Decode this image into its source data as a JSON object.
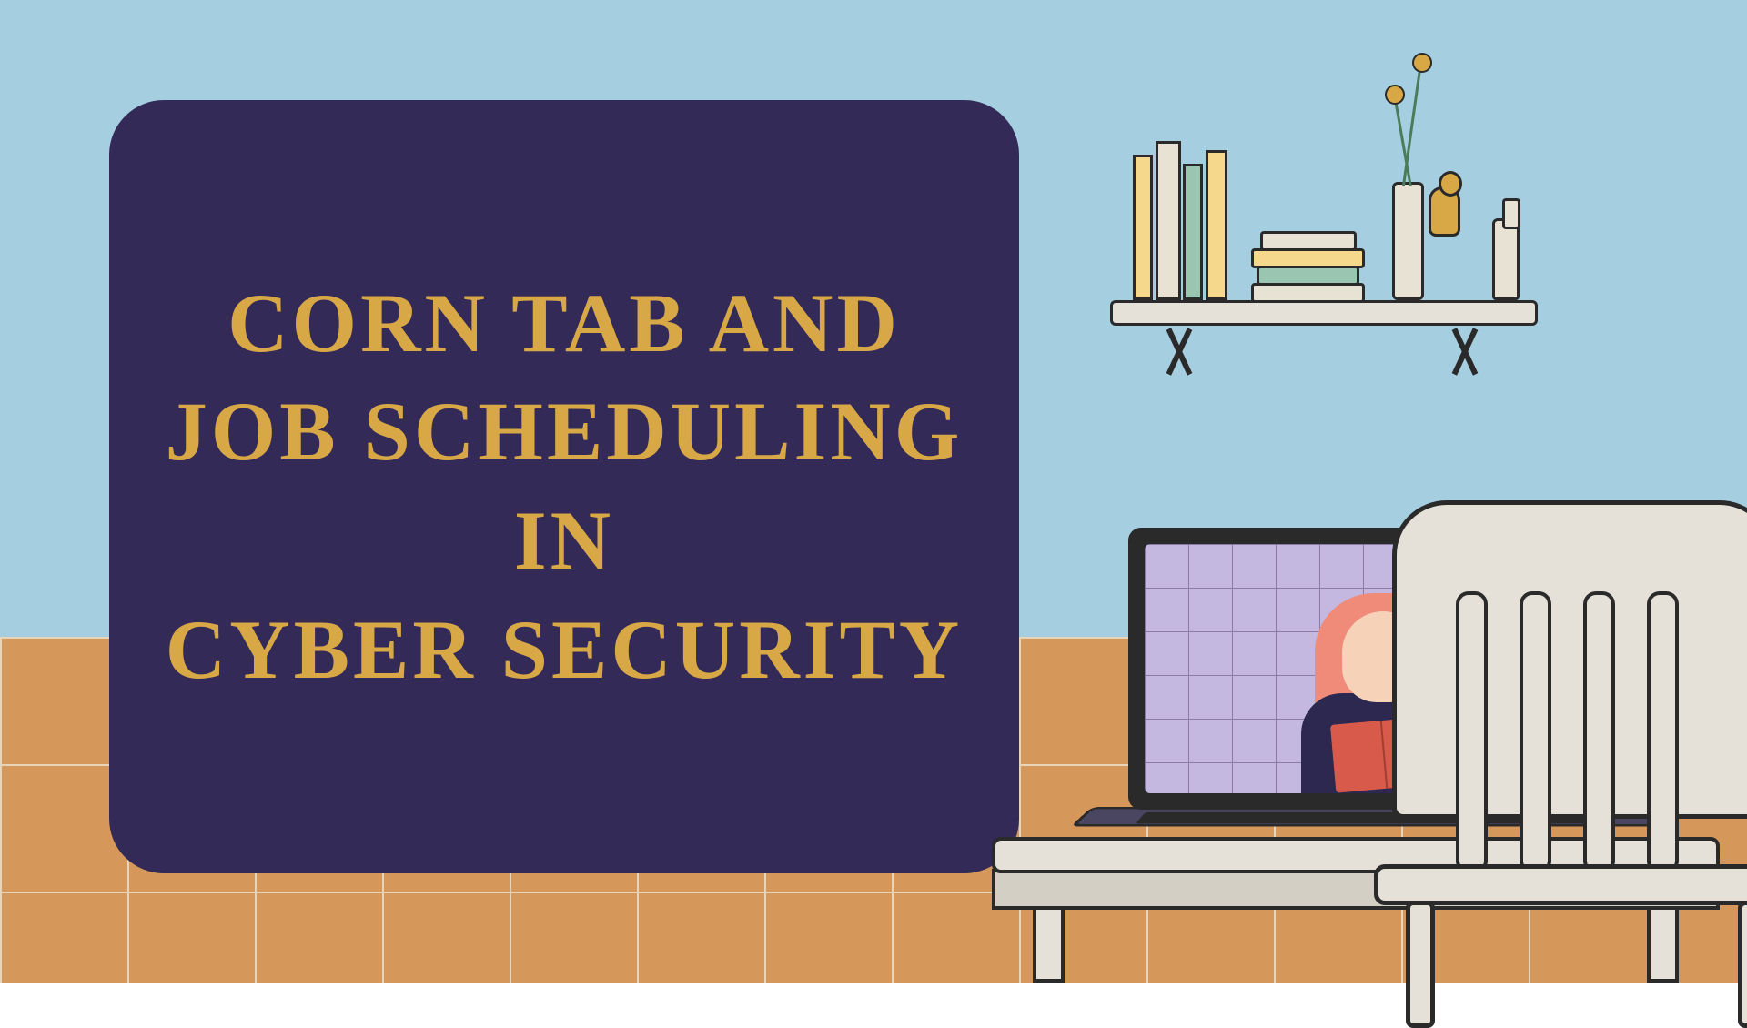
{
  "card": {
    "title": "CORN TAB AND\nJOB SCHEDULING\nIN\nCYBER SECURITY"
  }
}
